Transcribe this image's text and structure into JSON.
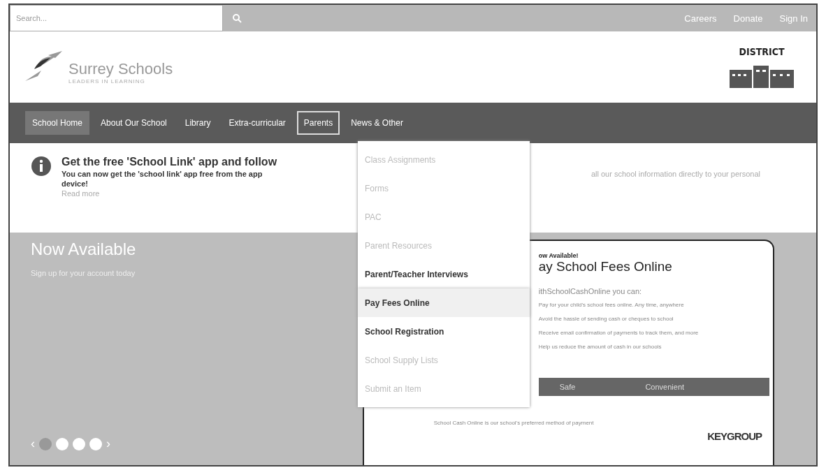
{
  "top_bar": {
    "search": {
      "placeholder": "Search..."
    },
    "links": [
      "Careers",
      "Donate",
      "Sign In"
    ]
  },
  "header": {
    "logo_name": "Surrey Schools",
    "tagline": "LEADERS IN LEARNING",
    "district_label": "DISTRICT"
  },
  "nav": [
    {
      "label": "School Home",
      "selected": true
    },
    {
      "label": "About Our School",
      "selected": false
    },
    {
      "label": "Library",
      "selected": false
    },
    {
      "label": "Extra-curricular",
      "selected": false
    },
    {
      "label": "Parents",
      "selected": false,
      "open": true
    },
    {
      "label": "News & Other",
      "selected": false
    }
  ],
  "dropdown": [
    {
      "label": "Class Assignments",
      "faded": true,
      "selected": false
    },
    {
      "label": "Forms",
      "faded": true,
      "selected": false
    },
    {
      "label": "PAC",
      "faded": true,
      "selected": false
    },
    {
      "label": "Parent Resources",
      "faded": true,
      "selected": false
    },
    {
      "label": "Parent/Teacher Interviews",
      "faded": false,
      "selected": false
    },
    {
      "label": "Pay Fees Online",
      "faded": false,
      "selected": true
    },
    {
      "label": "School Registration",
      "faded": false,
      "selected": false
    },
    {
      "label": "School Supply Lists",
      "faded": true,
      "selected": false
    },
    {
      "label": "Submit an Item",
      "faded": true,
      "selected": false
    }
  ],
  "notice": {
    "title": "Get the free 'School Link' app and follow",
    "text_left": "You can now get the 'school link' app free from the app",
    "text_right": "all our school information directly to your personal",
    "text_end": "device!",
    "link": "Read more"
  },
  "hero": {
    "title": "Now Available",
    "subtitle": "Sign up for your account today",
    "prev": "‹",
    "next": "›",
    "dots": [
      {
        "selected": true
      },
      {
        "selected": false
      },
      {
        "selected": false
      },
      {
        "selected": false
      }
    ],
    "card": {
      "eyebrow": "ow Available!",
      "title": "ay School Fees Online",
      "intro": "ithSchoolCashOnline you can:",
      "bullets": [
        "Pay for your child's school fees online. Any time, anywhere",
        "Avoid the hassle of sending cash or cheques to school",
        "Receive email confirmation of payments to track them, and more",
        "Help us reduce the amount of cash in our schools"
      ],
      "badges": [
        "Safe",
        "Convenient"
      ],
      "footer": "School Cash Online is our school's preferred method of payment",
      "brand": "KEYGROUP"
    }
  }
}
